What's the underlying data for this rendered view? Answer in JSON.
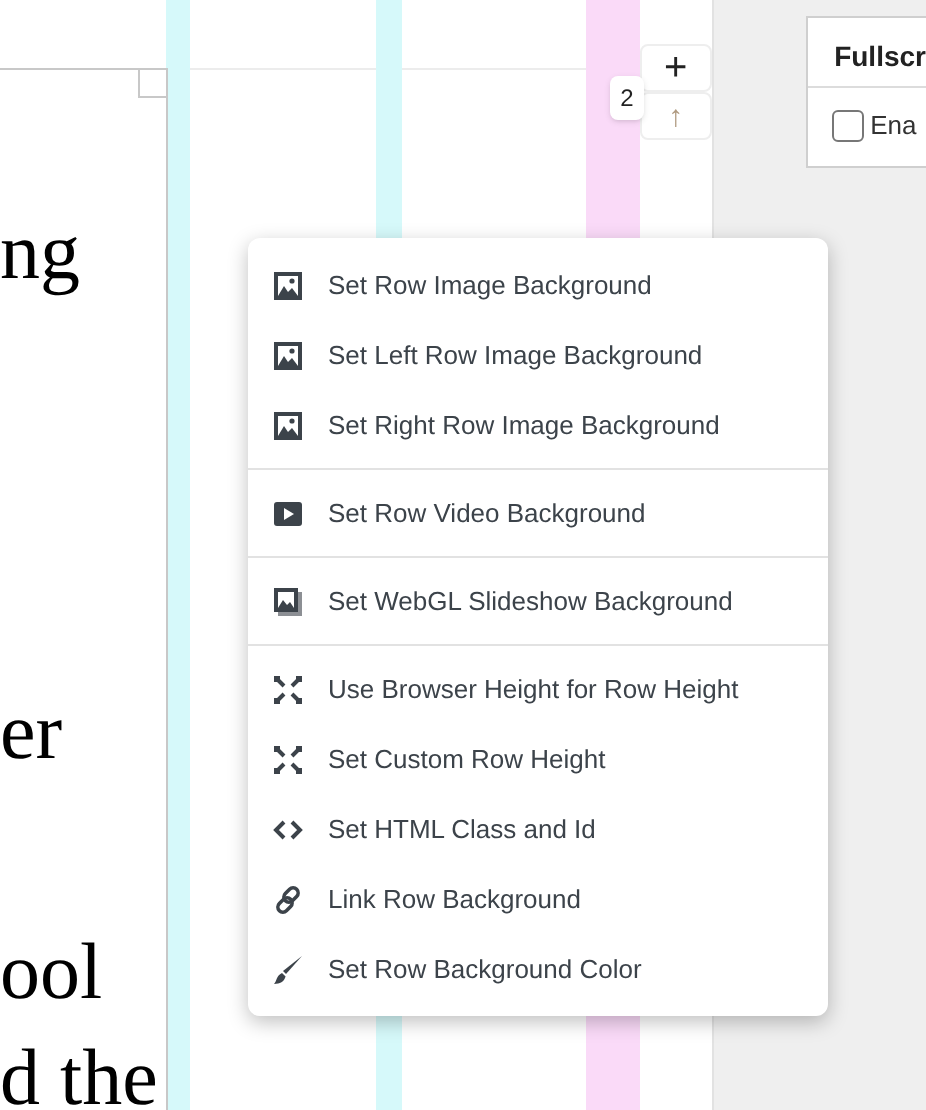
{
  "editor_text": [
    "ng",
    "er",
    "ool",
    "d the"
  ],
  "row_badge": "2",
  "row_controls": {
    "add": "+",
    "move_up": "↑"
  },
  "settings_panel": {
    "title": "Fullscr",
    "checkbox": {
      "label": "Ena",
      "checked": false
    }
  },
  "context_menu": {
    "groups": [
      {
        "items": [
          {
            "label": "Set Row Image Background",
            "kind": "image"
          },
          {
            "label": "Set Left Row Image Background",
            "kind": "image"
          },
          {
            "label": "Set Right Row Image Background",
            "kind": "image"
          }
        ]
      },
      {
        "items": [
          {
            "label": "Set Row Video Background",
            "kind": "video"
          }
        ]
      },
      {
        "items": [
          {
            "label": "Set WebGL Slideshow Background",
            "kind": "slideshow"
          }
        ]
      },
      {
        "items": [
          {
            "label": "Use Browser Height for Row Height",
            "kind": "height"
          },
          {
            "label": "Set Custom Row Height",
            "kind": "height"
          },
          {
            "label": "Set HTML Class and Id",
            "kind": "code"
          },
          {
            "label": "Link Row Background",
            "kind": "link"
          },
          {
            "label": "Set Row Background Color",
            "kind": "color"
          }
        ]
      }
    ]
  }
}
